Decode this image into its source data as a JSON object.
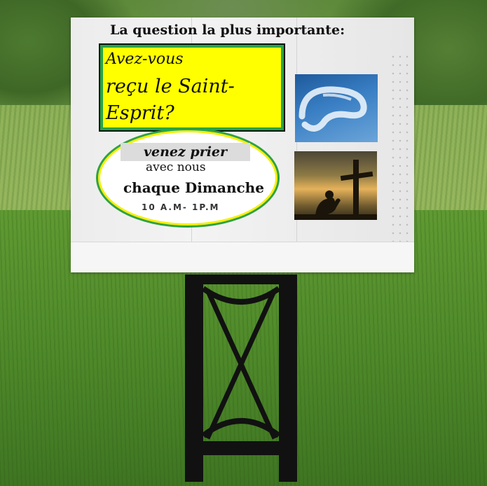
{
  "sign": {
    "headline": "La question la plus importante:",
    "question": {
      "line1": "Avez-vous",
      "line2": "reçu le Saint-",
      "line3": "Esprit?"
    },
    "invitation": {
      "line1": "venez prier",
      "line2": "avec nous",
      "line3": "chaque Dimanche",
      "hours": "10 A.M- 1P.M"
    }
  },
  "images": {
    "top": "sky-cloud-photo",
    "bottom": "cross-prayer-photo"
  },
  "colors": {
    "question_background": "#ffff00",
    "box_border": "#26a544",
    "oval_border_outer": "#2ea243",
    "oval_border_inner": "#f7ef00"
  }
}
